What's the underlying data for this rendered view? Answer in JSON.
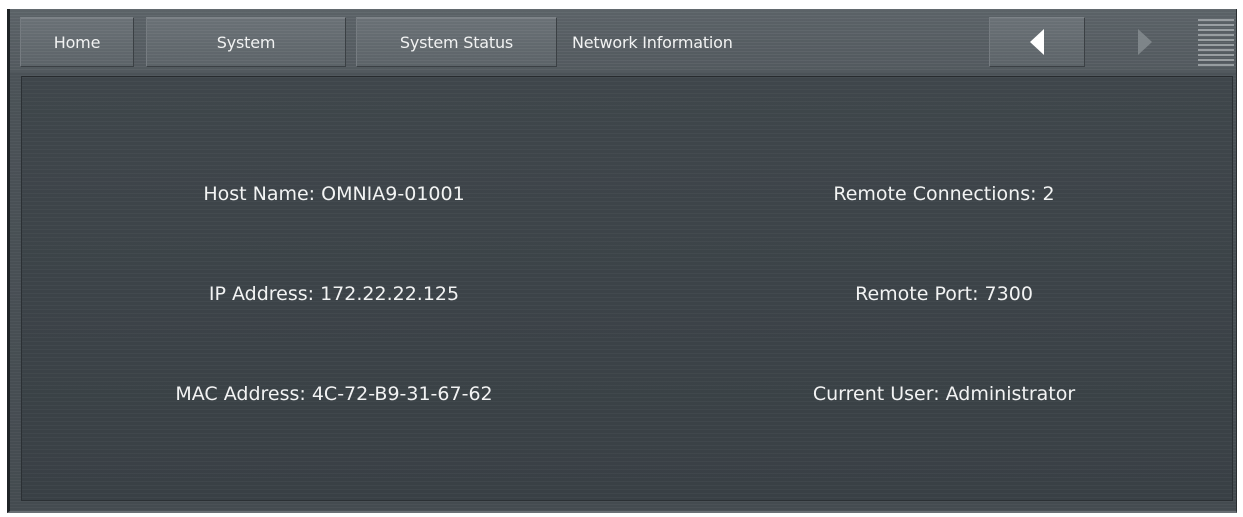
{
  "nav": {
    "tabs": [
      {
        "label": "Home"
      },
      {
        "label": "System"
      },
      {
        "label": "System Status"
      }
    ],
    "current": "Network Information",
    "back_icon": "triangle-left-icon",
    "forward_icon": "triangle-right-icon",
    "menu_icon": "menu-lines-icon"
  },
  "info": {
    "host_name": "Host Name: OMNIA9-01001",
    "ip_address": "IP Address: 172.22.22.125",
    "mac_address": "MAC Address: 4C-72-B9-31-67-62",
    "remote_connections": "Remote Connections: 2",
    "remote_port": "Remote Port: 7300",
    "current_user": "Current User: Administrator"
  },
  "colors": {
    "panel_background": "#3f464b",
    "toolbar_background": "#5b6267",
    "text": "#f2f3f3"
  }
}
